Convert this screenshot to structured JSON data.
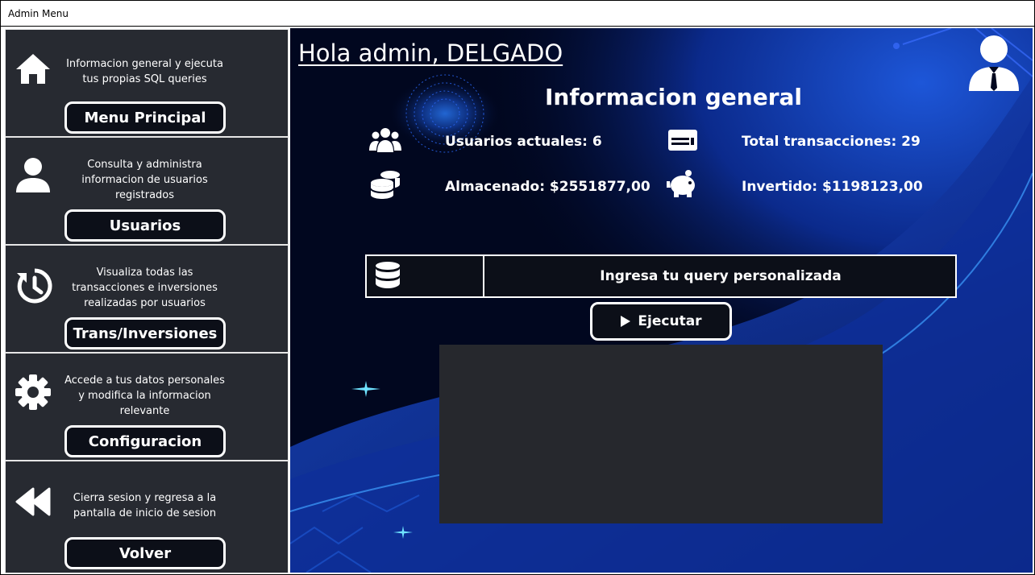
{
  "window": {
    "title": "Admin Menu"
  },
  "sidebar": {
    "items": [
      {
        "icon": "home-icon",
        "description": "Informacion general y ejecuta tus propias SQL queries",
        "button": "Menu Principal"
      },
      {
        "icon": "user-icon",
        "description": "Consulta y administra informacion de usuarios registrados",
        "button": "Usuarios"
      },
      {
        "icon": "history-icon",
        "description": "Visualiza todas las transacciones e inversiones realizadas por usuarios",
        "button": "Trans/Inversiones"
      },
      {
        "icon": "gear-icon",
        "description": "Accede a tus datos personales y modifica la informacion relevante",
        "button": "Configuracion"
      },
      {
        "icon": "rewind-icon",
        "description": "Cierra sesion y regresa a la pantalla de inicio de sesion",
        "button": "Volver"
      }
    ]
  },
  "main": {
    "greeting": "Hola admin, DELGADO",
    "section_title": "Informacion general",
    "stats": [
      {
        "icon": "users-icon",
        "text": "Usuarios actuales: 6"
      },
      {
        "icon": "card-icon",
        "text": "Total transacciones: 29"
      },
      {
        "icon": "coins-icon",
        "text": "Almacenado: $2551877,00"
      },
      {
        "icon": "piggy-bank-icon",
        "text": "Invertido: $1198123,00"
      }
    ],
    "query": {
      "placeholder": "Ingresa tu query personalizada",
      "value": ""
    },
    "execute_button": "Ejecutar",
    "colors": {
      "sidebar_bg": "#272a31",
      "button_bg": "#0c0f18",
      "main_bg": "#01071f",
      "results_bg": "#26282d",
      "accent": "#1e90ff"
    }
  }
}
